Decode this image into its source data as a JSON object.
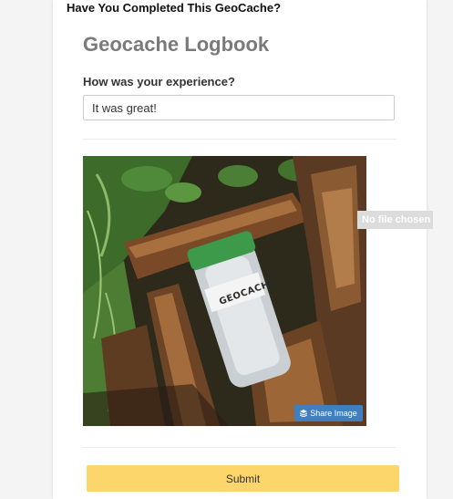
{
  "banner": {
    "title": "Have You Completed This GeoCache?"
  },
  "form": {
    "title": "Geocache Logbook",
    "experience_label": "How was your experience?",
    "experience_value": "It was great!",
    "file_status": "No file chosen",
    "submit_label": "Submit"
  },
  "photo": {
    "jar_label": "GEOCACHE",
    "share_label": "Share Image",
    "share_icon": "layers-icon"
  },
  "colors": {
    "submit_bg": "#fdd66b",
    "share_bg": "#3f7fbf",
    "title_color": "#7a7a7a"
  }
}
